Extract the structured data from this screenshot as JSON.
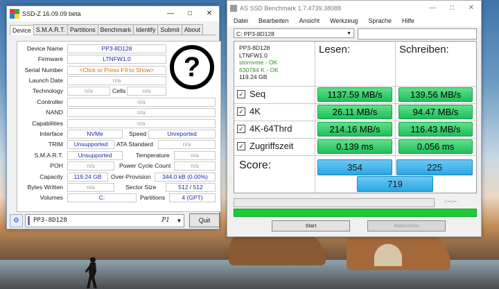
{
  "ssdz": {
    "title": "SSD-Z 16.09.09 beta",
    "tabs": [
      "Device",
      "S.M.A.R.T.",
      "Partitions",
      "Benchmark",
      "Identify",
      "Submit",
      "About"
    ],
    "labels": {
      "device_name": "Device Name",
      "firmware": "Firmware",
      "serial": "Serial Number",
      "launch_date": "Launch Date",
      "technology": "Technology",
      "cells": "Cells",
      "controller": "Controller",
      "nand": "NAND",
      "capabilities": "Capabilities",
      "interface": "Interface",
      "speed": "Speed",
      "trim": "TRIM",
      "ata_standard": "ATA Standard",
      "smart": "S.M.A.R.T.",
      "temperature": "Temperature",
      "poh": "POH",
      "power_cycle": "Power Cycle Count",
      "capacity": "Capacity",
      "over_provision": "Over-Provision",
      "bytes_written": "Bytes Written",
      "sector_size": "Sector Size",
      "volumes": "Volumes",
      "partitions": "Partitions"
    },
    "values": {
      "device_name": "PP3-8D128",
      "firmware": "LTNFW1.0",
      "serial": "<Click or Press F9 to Show>",
      "launch_date": "n/a",
      "technology": "n/a",
      "cells": "n/a",
      "controller": "n/a",
      "nand": "n/a",
      "capabilities": "n/a",
      "interface": "NVMe",
      "speed": "Unreported",
      "trim": "Unsupported",
      "ata_standard": "n/a",
      "smart": "Unsupported",
      "temperature": "n/a",
      "poh": "n/a",
      "power_cycle": "n/a",
      "capacity": "119.24 GB",
      "over_provision": "344.0 kB (0.00%)",
      "bytes_written": "n/a",
      "sector_size": "512 / 512",
      "volumes": "C:",
      "partitions": "4 (GPT)"
    },
    "drive_combo": "PP3-8D128",
    "drive_combo_suffix": "P1",
    "quit_label": "Quit"
  },
  "asssd": {
    "title": "AS SSD Benchmark 1.7.4739.38088",
    "menu": [
      "Datei",
      "Bearbeiten",
      "Ansicht",
      "Werkzeug",
      "Sprache",
      "Hilfe"
    ],
    "drive_select": "C: PP3-8D128",
    "info": {
      "model": "PP3-8D128",
      "firmware": "LTNFW1.0",
      "driver": "stornvme - OK",
      "align": "630784 K - OK",
      "size": "119.24 GB"
    },
    "col_read": "Lesen:",
    "col_write": "Schreiben:",
    "tests": [
      {
        "label": "Seq",
        "read": "1137.59 MB/s",
        "write": "139.56 MB/s"
      },
      {
        "label": "4K",
        "read": "26.11 MB/s",
        "write": "94.47 MB/s"
      },
      {
        "label": "4K-64Thrd",
        "read": "214.16 MB/s",
        "write": "116.43 MB/s"
      },
      {
        "label": "Zugriffszeit",
        "read": "0.139 ms",
        "write": "0.056 ms"
      }
    ],
    "score_label": "Score:",
    "score_read": "354",
    "score_write": "225",
    "score_total": "719",
    "time_display": "-:--:--",
    "start_label": "Start",
    "abort_label": "Abbrechen"
  }
}
